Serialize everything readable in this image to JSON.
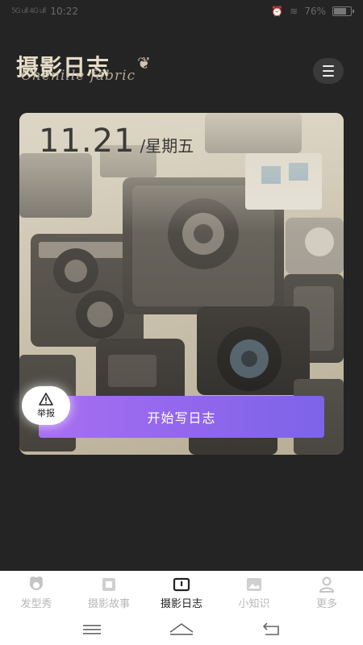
{
  "status_bar": {
    "carrier": "5G ull 4G ull",
    "time": "10:22",
    "wifi_icon": "wifi-icon",
    "alarm_icon": "alarm-icon",
    "battery_percent": "76%",
    "battery_level": 0.76
  },
  "header": {
    "logo_title": "摄影日志",
    "logo_script": "Chenille fabric",
    "menu_icon": "hamburger-menu-icon"
  },
  "card": {
    "date": "11.21",
    "weekday": "/星期五",
    "cta_label": "开始写日志",
    "cta_gradient": [
      "#a86ff0",
      "#7c64e8"
    ]
  },
  "report": {
    "label": "举报",
    "icon": "warning-icon"
  },
  "tabs": [
    {
      "label": "发型秀",
      "icon": "hair-icon",
      "active": false
    },
    {
      "label": "摄影故事",
      "icon": "photo-frame-icon",
      "active": false
    },
    {
      "label": "摄影日志",
      "icon": "journal-icon",
      "active": true
    },
    {
      "label": "小知识",
      "icon": "image-icon",
      "active": false
    },
    {
      "label": "更多",
      "icon": "person-icon",
      "active": false
    }
  ],
  "nav": {
    "menu_icon": "nav-menu-icon",
    "home_icon": "nav-home-icon",
    "back_icon": "nav-back-icon"
  },
  "colors": {
    "background": "#242424",
    "tab_active": "#222222",
    "tab_inactive": "#b8b8b8"
  }
}
